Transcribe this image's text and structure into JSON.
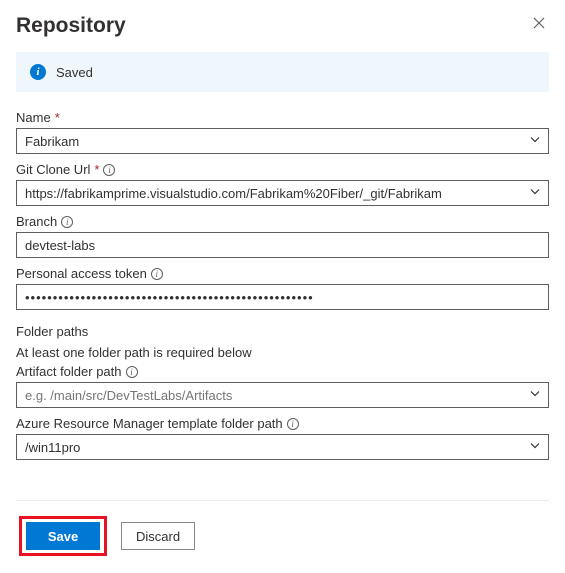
{
  "header": {
    "title": "Repository"
  },
  "notice": {
    "message": "Saved"
  },
  "fields": {
    "name": {
      "label": "Name",
      "value": "Fabrikam"
    },
    "gitUrl": {
      "label": "Git Clone Url",
      "value": "https://fabrikamprime.visualstudio.com/Fabrikam%20Fiber/_git/Fabrikam"
    },
    "branch": {
      "label": "Branch",
      "value": "devtest-labs"
    },
    "pat": {
      "label": "Personal access token",
      "value": "••••••••••••••••••••••••••••••••••••••••••••••••••••"
    }
  },
  "folder": {
    "section": "Folder paths",
    "hint": "At least one folder path is required below",
    "artifact": {
      "label": "Artifact folder path",
      "placeholder": "e.g. /main/src/DevTestLabs/Artifacts"
    },
    "arm": {
      "label": "Azure Resource Manager template folder path",
      "value": "/win11pro"
    }
  },
  "buttons": {
    "save": "Save",
    "discard": "Discard"
  }
}
